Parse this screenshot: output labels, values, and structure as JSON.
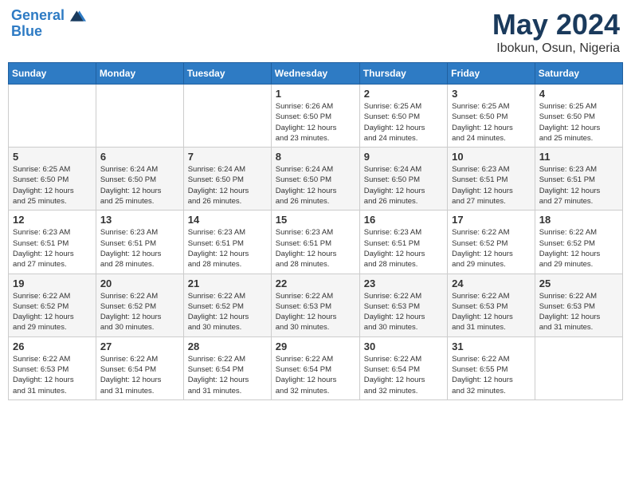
{
  "header": {
    "logo_line1": "General",
    "logo_line2": "Blue",
    "month": "May 2024",
    "location": "Ibokun, Osun, Nigeria"
  },
  "weekdays": [
    "Sunday",
    "Monday",
    "Tuesday",
    "Wednesday",
    "Thursday",
    "Friday",
    "Saturday"
  ],
  "weeks": [
    [
      {
        "day": "",
        "info": ""
      },
      {
        "day": "",
        "info": ""
      },
      {
        "day": "",
        "info": ""
      },
      {
        "day": "1",
        "info": "Sunrise: 6:26 AM\nSunset: 6:50 PM\nDaylight: 12 hours\nand 23 minutes."
      },
      {
        "day": "2",
        "info": "Sunrise: 6:25 AM\nSunset: 6:50 PM\nDaylight: 12 hours\nand 24 minutes."
      },
      {
        "day": "3",
        "info": "Sunrise: 6:25 AM\nSunset: 6:50 PM\nDaylight: 12 hours\nand 24 minutes."
      },
      {
        "day": "4",
        "info": "Sunrise: 6:25 AM\nSunset: 6:50 PM\nDaylight: 12 hours\nand 25 minutes."
      }
    ],
    [
      {
        "day": "5",
        "info": "Sunrise: 6:25 AM\nSunset: 6:50 PM\nDaylight: 12 hours\nand 25 minutes."
      },
      {
        "day": "6",
        "info": "Sunrise: 6:24 AM\nSunset: 6:50 PM\nDaylight: 12 hours\nand 25 minutes."
      },
      {
        "day": "7",
        "info": "Sunrise: 6:24 AM\nSunset: 6:50 PM\nDaylight: 12 hours\nand 26 minutes."
      },
      {
        "day": "8",
        "info": "Sunrise: 6:24 AM\nSunset: 6:50 PM\nDaylight: 12 hours\nand 26 minutes."
      },
      {
        "day": "9",
        "info": "Sunrise: 6:24 AM\nSunset: 6:50 PM\nDaylight: 12 hours\nand 26 minutes."
      },
      {
        "day": "10",
        "info": "Sunrise: 6:23 AM\nSunset: 6:51 PM\nDaylight: 12 hours\nand 27 minutes."
      },
      {
        "day": "11",
        "info": "Sunrise: 6:23 AM\nSunset: 6:51 PM\nDaylight: 12 hours\nand 27 minutes."
      }
    ],
    [
      {
        "day": "12",
        "info": "Sunrise: 6:23 AM\nSunset: 6:51 PM\nDaylight: 12 hours\nand 27 minutes."
      },
      {
        "day": "13",
        "info": "Sunrise: 6:23 AM\nSunset: 6:51 PM\nDaylight: 12 hours\nand 28 minutes."
      },
      {
        "day": "14",
        "info": "Sunrise: 6:23 AM\nSunset: 6:51 PM\nDaylight: 12 hours\nand 28 minutes."
      },
      {
        "day": "15",
        "info": "Sunrise: 6:23 AM\nSunset: 6:51 PM\nDaylight: 12 hours\nand 28 minutes."
      },
      {
        "day": "16",
        "info": "Sunrise: 6:23 AM\nSunset: 6:51 PM\nDaylight: 12 hours\nand 28 minutes."
      },
      {
        "day": "17",
        "info": "Sunrise: 6:22 AM\nSunset: 6:52 PM\nDaylight: 12 hours\nand 29 minutes."
      },
      {
        "day": "18",
        "info": "Sunrise: 6:22 AM\nSunset: 6:52 PM\nDaylight: 12 hours\nand 29 minutes."
      }
    ],
    [
      {
        "day": "19",
        "info": "Sunrise: 6:22 AM\nSunset: 6:52 PM\nDaylight: 12 hours\nand 29 minutes."
      },
      {
        "day": "20",
        "info": "Sunrise: 6:22 AM\nSunset: 6:52 PM\nDaylight: 12 hours\nand 30 minutes."
      },
      {
        "day": "21",
        "info": "Sunrise: 6:22 AM\nSunset: 6:52 PM\nDaylight: 12 hours\nand 30 minutes."
      },
      {
        "day": "22",
        "info": "Sunrise: 6:22 AM\nSunset: 6:53 PM\nDaylight: 12 hours\nand 30 minutes."
      },
      {
        "day": "23",
        "info": "Sunrise: 6:22 AM\nSunset: 6:53 PM\nDaylight: 12 hours\nand 30 minutes."
      },
      {
        "day": "24",
        "info": "Sunrise: 6:22 AM\nSunset: 6:53 PM\nDaylight: 12 hours\nand 31 minutes."
      },
      {
        "day": "25",
        "info": "Sunrise: 6:22 AM\nSunset: 6:53 PM\nDaylight: 12 hours\nand 31 minutes."
      }
    ],
    [
      {
        "day": "26",
        "info": "Sunrise: 6:22 AM\nSunset: 6:53 PM\nDaylight: 12 hours\nand 31 minutes."
      },
      {
        "day": "27",
        "info": "Sunrise: 6:22 AM\nSunset: 6:54 PM\nDaylight: 12 hours\nand 31 minutes."
      },
      {
        "day": "28",
        "info": "Sunrise: 6:22 AM\nSunset: 6:54 PM\nDaylight: 12 hours\nand 31 minutes."
      },
      {
        "day": "29",
        "info": "Sunrise: 6:22 AM\nSunset: 6:54 PM\nDaylight: 12 hours\nand 32 minutes."
      },
      {
        "day": "30",
        "info": "Sunrise: 6:22 AM\nSunset: 6:54 PM\nDaylight: 12 hours\nand 32 minutes."
      },
      {
        "day": "31",
        "info": "Sunrise: 6:22 AM\nSunset: 6:55 PM\nDaylight: 12 hours\nand 32 minutes."
      },
      {
        "day": "",
        "info": ""
      }
    ]
  ]
}
